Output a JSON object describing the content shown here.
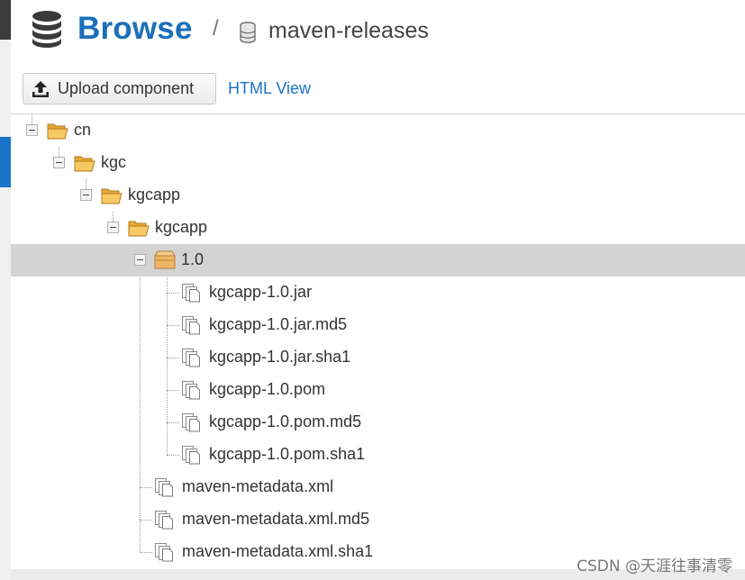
{
  "header": {
    "title": "Browse",
    "separator": "/",
    "repository": "maven-releases"
  },
  "toolbar": {
    "upload_label": "Upload component",
    "html_view_label": "HTML View"
  },
  "tree": {
    "nodes": [
      {
        "label": "cn",
        "type": "folder"
      },
      {
        "label": "kgc",
        "type": "folder"
      },
      {
        "label": "kgcapp",
        "type": "folder"
      },
      {
        "label": "kgcapp",
        "type": "folder"
      },
      {
        "label": "1.0",
        "type": "package",
        "selected": true
      },
      {
        "label": "kgcapp-1.0.jar",
        "type": "file"
      },
      {
        "label": "kgcapp-1.0.jar.md5",
        "type": "file"
      },
      {
        "label": "kgcapp-1.0.jar.sha1",
        "type": "file"
      },
      {
        "label": "kgcapp-1.0.pom",
        "type": "file"
      },
      {
        "label": "kgcapp-1.0.pom.md5",
        "type": "file"
      },
      {
        "label": "kgcapp-1.0.pom.sha1",
        "type": "file"
      },
      {
        "label": "maven-metadata.xml",
        "type": "file"
      },
      {
        "label": "maven-metadata.xml.md5",
        "type": "file"
      },
      {
        "label": "maven-metadata.xml.sha1",
        "type": "file"
      }
    ]
  },
  "watermark": "CSDN @天涯往事清零",
  "colors": {
    "brand_blue": "#1a6fb8",
    "link_blue": "#1a73c6",
    "selected_row": "#d3d3d3",
    "folder": "#f0b84a"
  },
  "icons": {
    "header": "database-icon",
    "repository": "database-cylinder-icon",
    "upload": "upload-icon",
    "folder": "folder-open-icon",
    "package": "package-icon",
    "file": "file-stack-icon"
  }
}
